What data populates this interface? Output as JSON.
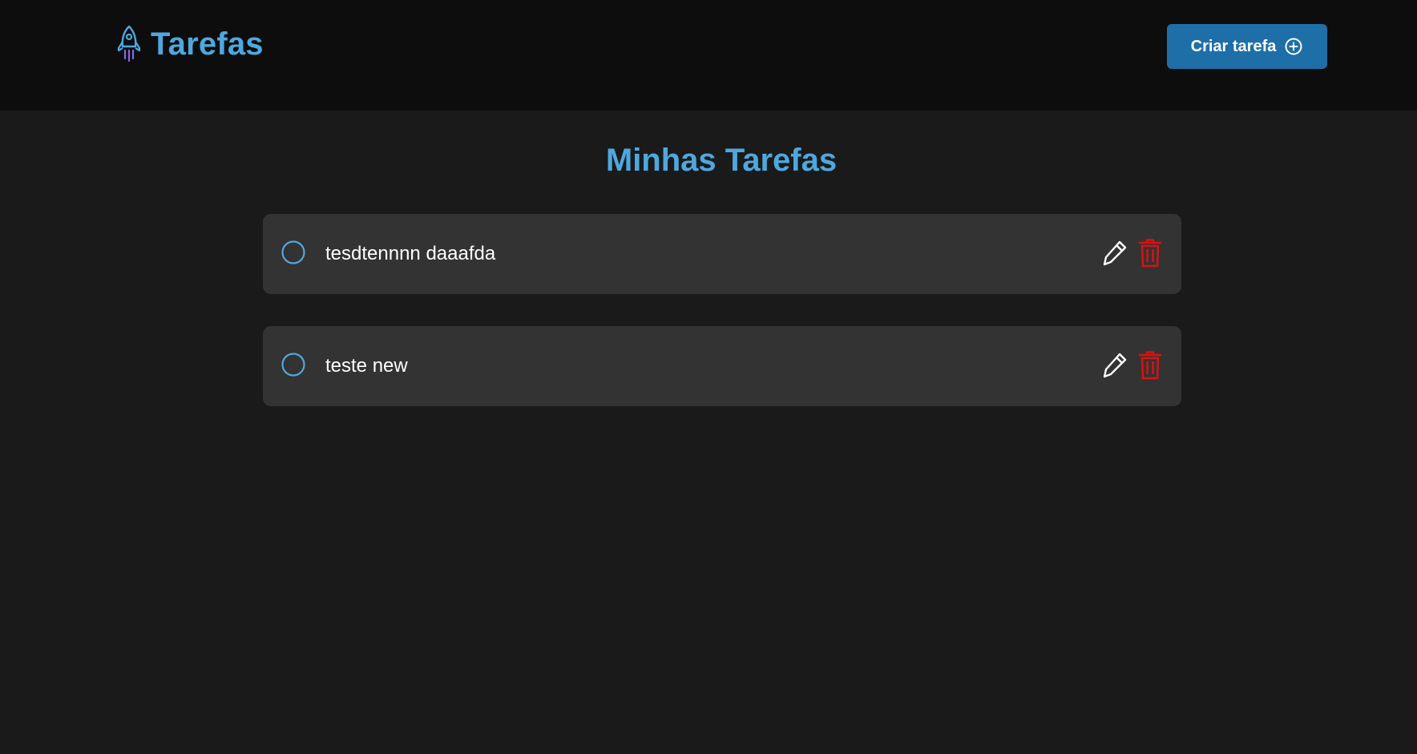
{
  "header": {
    "title": "Tarefas",
    "create_label": "Criar tarefa"
  },
  "main": {
    "heading": "Minhas Tarefas"
  },
  "tasks": [
    {
      "title": "tesdtennnn daaafda",
      "completed": false
    },
    {
      "title": "teste new",
      "completed": false
    }
  ],
  "icons": {
    "brand": "rocket-icon",
    "create": "plus-circle-icon",
    "check": "circle-icon",
    "edit": "pencil-icon",
    "delete": "trash-icon"
  },
  "colors": {
    "accent": "#4ea8de",
    "button": "#1e6fa8",
    "danger": "#e01010",
    "header_bg": "#0d0d0d",
    "page_bg": "#1a1a1a",
    "card_bg": "#333333"
  }
}
